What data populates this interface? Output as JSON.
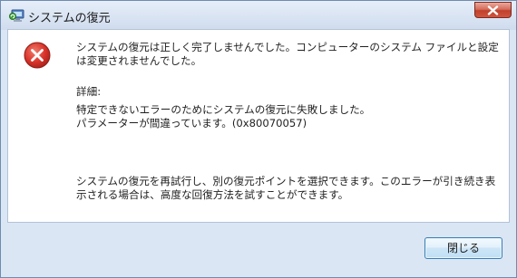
{
  "window": {
    "title": "システムの復元",
    "app_icon": "system-restore-icon",
    "close_icon": "close-icon"
  },
  "dialog": {
    "icon": "error-icon",
    "main_message": "システムの復元は正しく完了しませんでした。コンピューターのシステム ファイルと設定は変更されませんでした。",
    "details_label": "詳細:",
    "details_line1": "特定できないエラーのためにシステムの復元に失敗しました。",
    "details_line2": "パラメーターが間違っています。(0x80070057)",
    "retry_message": "システムの復元を再試行し、別の復元ポイントを選択できます。このエラーが引き続き表示される場合は、高度な回復方法を試すことができます。"
  },
  "buttons": {
    "close_label": "閉じる"
  },
  "colors": {
    "error_red": "#d9332a",
    "window_frame": "#dbe6f4",
    "close_button_red": "#c0402c"
  }
}
